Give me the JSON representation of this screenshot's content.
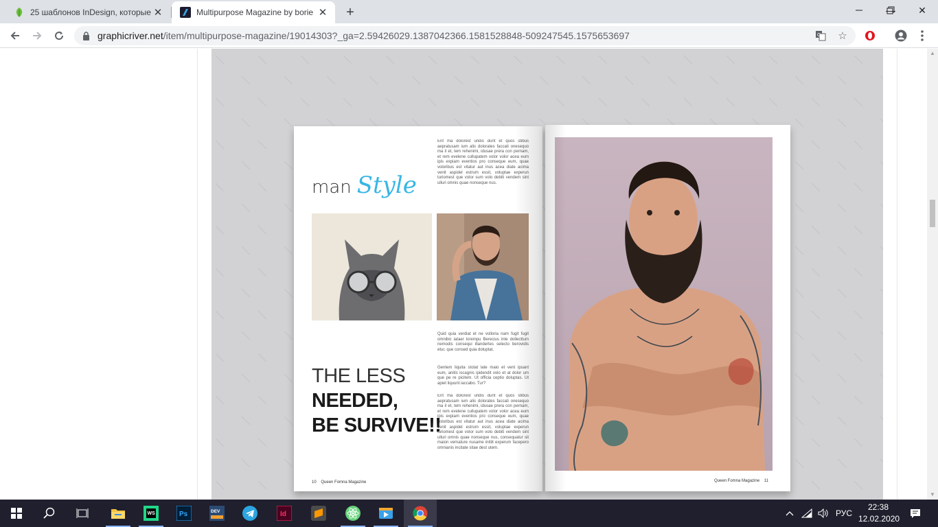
{
  "browser": {
    "tabs": [
      {
        "title": "25 шаблонов InDesign, которые",
        "favicon": "leaf-icon",
        "active": false
      },
      {
        "title": "Multipurpose Magazine by borie",
        "favicon": "envato-icon",
        "active": true
      }
    ],
    "new_tab": "+",
    "window_controls": {
      "minimize": "—",
      "maximize": "❐",
      "close": "✕"
    },
    "url": {
      "host": "graphicriver.net",
      "path": "/item/multipurpose-magazine/19014303?_ga=2.59426029.1387042366.1581528848-509247545.1575653697"
    },
    "icons": [
      "back-icon",
      "forward-icon",
      "reload-icon",
      "lock-icon",
      "translate-icon",
      "star-icon",
      "opera-icon",
      "account-icon",
      "menu-icon"
    ]
  },
  "magazine": {
    "logo": {
      "word1": "man",
      "word2": "Style"
    },
    "headline": {
      "line1": "THE LESS",
      "line2": "NEEDED,",
      "line3": "BE SURVIVE!!"
    },
    "top_text": "Ent ma dolorest undis dunt et quos stibus aepratusam ium alis dolorates faccati onesequo ma il et, tem rehenimi, idusae prera con pernam, et rem evelene cullupatem volor volor acea eum ipis expiam eventios pro conseque eum, quae voloribus est vitatur aut inus acea diate acima venit aspidel estrum essit, voluptae experun turiomest que volor sum volo debiti vendem sint ulluri omnis quae nonseque nus.",
    "mid_text_1": "Quid quia verdiat et ne volloria nam fugit fugit omnibic iataer lorempu Berecius inte dollecttum nemodis consequi illandertes selecto berovidis etur, que consed quia doluptat.",
    "mid_text_2": "Gentem liquita stotat late maio et vent ipsant eum, anitis iscagnis ipidendit volo et at dolor um que pe re picitem. Ut officia ceptio doluptas. Ut apiet liquunt iaccabo. Tur?",
    "bottom_text": "Ent ma dolorest undis dunt et quos stibus aepratusam ium alis dolorates faccati onesequo ma il et, tem rehenimi, idusae prera con pernam, et rem evelene cullupatem volor volor acea eum ipis expiam eventios pro conseque eum, quae voloribus est vitatur aut inus acea diate acima venit aspidel estrum essit, voluptae experun turiomest que volor sum volo debiti vendem sint ulluri omnis quae nonseque nus, consequatur sit maion vernature nusame initiit experum facepero omnianis incitate sitae dest utem.",
    "footer_left": {
      "page": "10",
      "title": "Queen Fomna Magazine"
    },
    "footer_right": {
      "page": "11",
      "title": "Queen Fomna Magazine"
    },
    "watermark": "envato"
  },
  "taskbar": {
    "apps": [
      "windows-start-icon",
      "search-icon",
      "task-view-icon",
      "file-explorer-icon",
      "webstorm-icon",
      "photoshop-icon",
      "devexpress-icon",
      "telegram-icon",
      "indesign-icon",
      "sublime-text-icon",
      "atom-icon",
      "video-player-icon",
      "chrome-icon"
    ],
    "app_labels": {
      "webstorm": "WS",
      "photoshop": "Ps",
      "devexpress": "DEV",
      "indesign": "Id"
    },
    "language": "РУС",
    "time": "22:38",
    "date": "12.02.2020"
  },
  "colors": {
    "accent_blue": "#39b6e4",
    "tabstrip": "#dee1e6",
    "taskbar": "#1f1f2e",
    "preview_bg": "#d2d2d4"
  }
}
